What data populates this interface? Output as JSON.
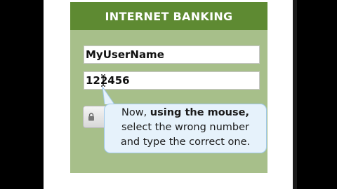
{
  "banking": {
    "title": "INTERNET BANKING",
    "username_value": "MyUserName",
    "password_value": "122456"
  },
  "callout": {
    "line1_prefix": "Now, ",
    "line1_bold": "using the mouse,",
    "line2": "select the wrong number",
    "line3": "and type the correct one."
  },
  "colors": {
    "header_green": "#5e8a32",
    "panel_green": "#a7bf8a",
    "callout_bg": "#e6f2fb"
  }
}
